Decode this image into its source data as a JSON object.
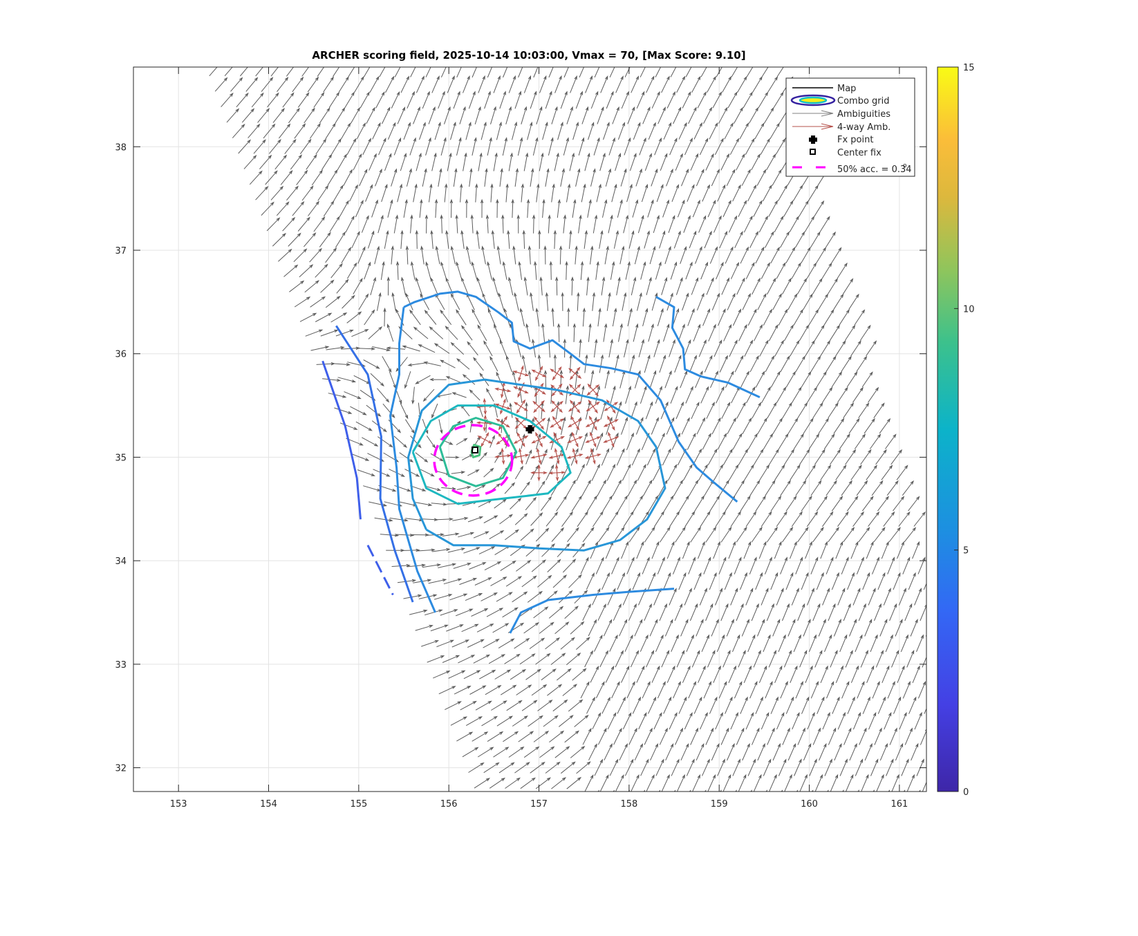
{
  "chart_data": {
    "type": "quiver",
    "title": "ARCHER scoring field, 2025-10-14 10:03:00, Vmax = 70, [Max Score: 9.10]",
    "xlim": [
      152.5,
      161.3
    ],
    "ylim": [
      31.77,
      38.77
    ],
    "xticks": [
      "153",
      "154",
      "155",
      "156",
      "157",
      "158",
      "159",
      "160",
      "161"
    ],
    "yticks": [
      "32",
      "33",
      "34",
      "35",
      "36",
      "37",
      "38"
    ],
    "grid": true,
    "colorbar": {
      "range": [
        0,
        15
      ],
      "ticks": [
        "0",
        "5",
        "10",
        "15"
      ]
    },
    "legend": {
      "placement": "top-right",
      "entries": [
        "Map",
        "Combo grid",
        "Ambiguities",
        "4-way Amb.",
        "Fx point",
        "Center fix",
        "50% acc. = 0.34"
      ],
      "degree_mark": "o"
    },
    "fx_point": [
      156.9,
      35.27
    ],
    "center_fix": [
      156.29,
      35.07
    ],
    "accuracy_circle": {
      "center": [
        156.27,
        34.97
      ],
      "radius_deg": 0.34
    },
    "wind_field": {
      "vortex_center": [
        156.3,
        35.07
      ],
      "background_direction": "southwesterly",
      "swath_left_edge": [
        [
          153.4,
          38.77
        ],
        [
          156.4,
          31.77
        ]
      ],
      "swath_right_edge": [
        [
          159.8,
          38.77
        ],
        [
          161.3,
          34.2
        ]
      ]
    },
    "contours": [
      {
        "level": 4,
        "color": "#3f5fea",
        "points": [
          [
            154.6,
            35.93
          ],
          [
            154.85,
            35.3
          ],
          [
            154.98,
            34.8
          ],
          [
            155.02,
            34.4
          ]
        ]
      },
      {
        "level": 4,
        "color": "#3f5fea",
        "dashed": true,
        "points": [
          [
            155.1,
            34.15
          ],
          [
            155.38,
            33.67
          ]
        ]
      },
      {
        "level": 4.3,
        "color": "#3570e6",
        "points": [
          [
            154.75,
            36.27
          ],
          [
            155.1,
            35.8
          ],
          [
            155.25,
            35.2
          ],
          [
            155.24,
            34.6
          ],
          [
            155.4,
            34.1
          ],
          [
            155.6,
            33.6
          ]
        ]
      },
      {
        "level": 5,
        "color": "#2d8be0",
        "points": [
          [
            155.5,
            36.45
          ],
          [
            155.62,
            36.5
          ],
          [
            155.9,
            36.58
          ],
          [
            156.1,
            36.6
          ],
          [
            156.3,
            36.55
          ],
          [
            156.55,
            36.4
          ],
          [
            156.7,
            36.3
          ],
          [
            156.72,
            36.12
          ],
          [
            156.9,
            36.05
          ],
          [
            157.15,
            36.13
          ],
          [
            157.35,
            36.0
          ],
          [
            157.5,
            35.9
          ],
          [
            157.8,
            35.86
          ],
          [
            158.1,
            35.8
          ],
          [
            158.35,
            35.55
          ],
          [
            158.55,
            35.15
          ],
          [
            158.75,
            34.9
          ],
          [
            158.95,
            34.75
          ],
          [
            159.2,
            34.57
          ]
        ]
      },
      {
        "level": 5,
        "color": "#2d8be0",
        "points": [
          [
            155.5,
            36.45
          ],
          [
            155.45,
            36.1
          ],
          [
            155.45,
            35.8
          ],
          [
            155.35,
            35.4
          ],
          [
            155.42,
            34.9
          ],
          [
            155.45,
            34.5
          ],
          [
            155.55,
            34.2
          ],
          [
            155.65,
            33.9
          ],
          [
            155.8,
            33.6
          ],
          [
            155.85,
            33.5
          ]
        ]
      },
      {
        "level": 5.3,
        "color": "#2896d8",
        "points": [
          [
            155.75,
            34.3
          ],
          [
            156.05,
            34.15
          ],
          [
            156.5,
            34.15
          ],
          [
            157.0,
            34.12
          ],
          [
            157.5,
            34.1
          ],
          [
            157.9,
            34.2
          ],
          [
            158.2,
            34.4
          ],
          [
            158.4,
            34.7
          ],
          [
            158.3,
            35.1
          ],
          [
            158.1,
            35.35
          ],
          [
            157.7,
            35.55
          ],
          [
            157.2,
            35.65
          ],
          [
            156.8,
            35.7
          ],
          [
            156.4,
            35.75
          ],
          [
            156.0,
            35.7
          ],
          [
            155.7,
            35.45
          ],
          [
            155.55,
            35.0
          ],
          [
            155.6,
            34.6
          ],
          [
            155.75,
            34.3
          ]
        ]
      },
      {
        "level": 5,
        "color": "#2d8be0",
        "points": [
          [
            158.3,
            36.55
          ],
          [
            158.5,
            36.45
          ],
          [
            158.48,
            36.25
          ],
          [
            158.6,
            36.05
          ],
          [
            158.62,
            35.85
          ],
          [
            158.8,
            35.78
          ],
          [
            159.1,
            35.72
          ],
          [
            159.45,
            35.58
          ]
        ]
      },
      {
        "level": 5,
        "color": "#2d8be0",
        "points": [
          [
            156.68,
            33.3
          ],
          [
            156.8,
            33.5
          ],
          [
            157.1,
            33.62
          ],
          [
            157.6,
            33.67
          ],
          [
            158.0,
            33.7
          ],
          [
            158.5,
            33.73
          ]
        ]
      },
      {
        "level": 7,
        "color": "#1db8c0",
        "points": [
          [
            155.6,
            35.05
          ],
          [
            155.8,
            35.35
          ],
          [
            156.1,
            35.5
          ],
          [
            156.5,
            35.5
          ],
          [
            156.9,
            35.35
          ],
          [
            157.25,
            35.1
          ],
          [
            157.35,
            34.85
          ],
          [
            157.1,
            34.65
          ],
          [
            156.6,
            34.6
          ],
          [
            156.1,
            34.55
          ],
          [
            155.75,
            34.7
          ],
          [
            155.6,
            35.05
          ]
        ]
      },
      {
        "level": 8,
        "color": "#2dbd98",
        "points": [
          [
            155.9,
            35.1
          ],
          [
            156.05,
            35.3
          ],
          [
            156.3,
            35.38
          ],
          [
            156.6,
            35.3
          ],
          [
            156.75,
            35.05
          ],
          [
            156.6,
            34.8
          ],
          [
            156.3,
            34.72
          ],
          [
            156.0,
            34.82
          ],
          [
            155.9,
            35.1
          ]
        ]
      },
      {
        "level": 9,
        "color": "#47c27c",
        "points": [
          [
            156.25,
            35.05
          ],
          [
            156.28,
            35.12
          ],
          [
            156.35,
            35.1
          ],
          [
            156.34,
            35.02
          ],
          [
            156.27,
            35.0
          ],
          [
            156.25,
            35.05
          ]
        ]
      }
    ],
    "four_way_region": {
      "lon": [
        156.4,
        157.8
      ],
      "lat": [
        34.85,
        35.85
      ]
    }
  }
}
